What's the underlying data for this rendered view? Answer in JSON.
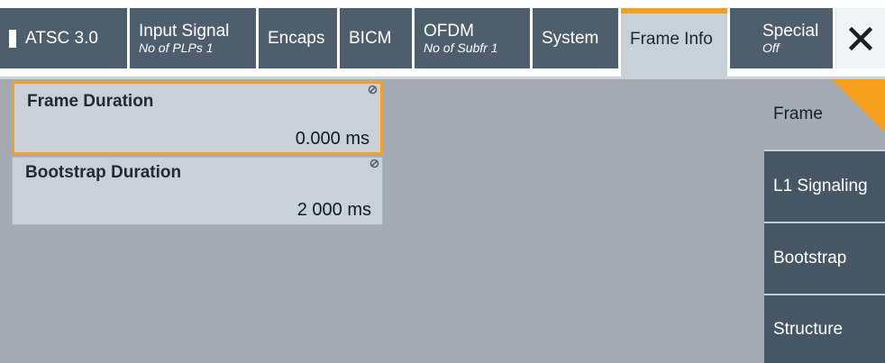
{
  "tabs": {
    "atsc": {
      "title": "ATSC 3.0"
    },
    "input_signal": {
      "title": "Input Signal",
      "sub": "No of PLPs 1"
    },
    "encaps": {
      "title": "Encaps"
    },
    "bicm": {
      "title": "BICM"
    },
    "ofdm": {
      "title": "OFDM",
      "sub": "No of Subfr 1"
    },
    "system": {
      "title": "System"
    },
    "frame_info": {
      "title": "Frame Info"
    },
    "special": {
      "title": "Special",
      "sub": "Off"
    }
  },
  "close_icon": "close-icon",
  "fields": {
    "frame_duration": {
      "label": "Frame Duration",
      "value": "0.000 ms"
    },
    "bootstrap_duration": {
      "label": "Bootstrap Duration",
      "value": "2 000 ms"
    }
  },
  "side_nav": {
    "frame": "Frame",
    "l1_signaling": "L1 Signaling",
    "bootstrap": "Bootstrap",
    "structure": "Structure"
  },
  "colors": {
    "accent": "#f5a01f",
    "tab": "#4f5e6c",
    "side": "#465664",
    "background": "#a4abb2"
  }
}
